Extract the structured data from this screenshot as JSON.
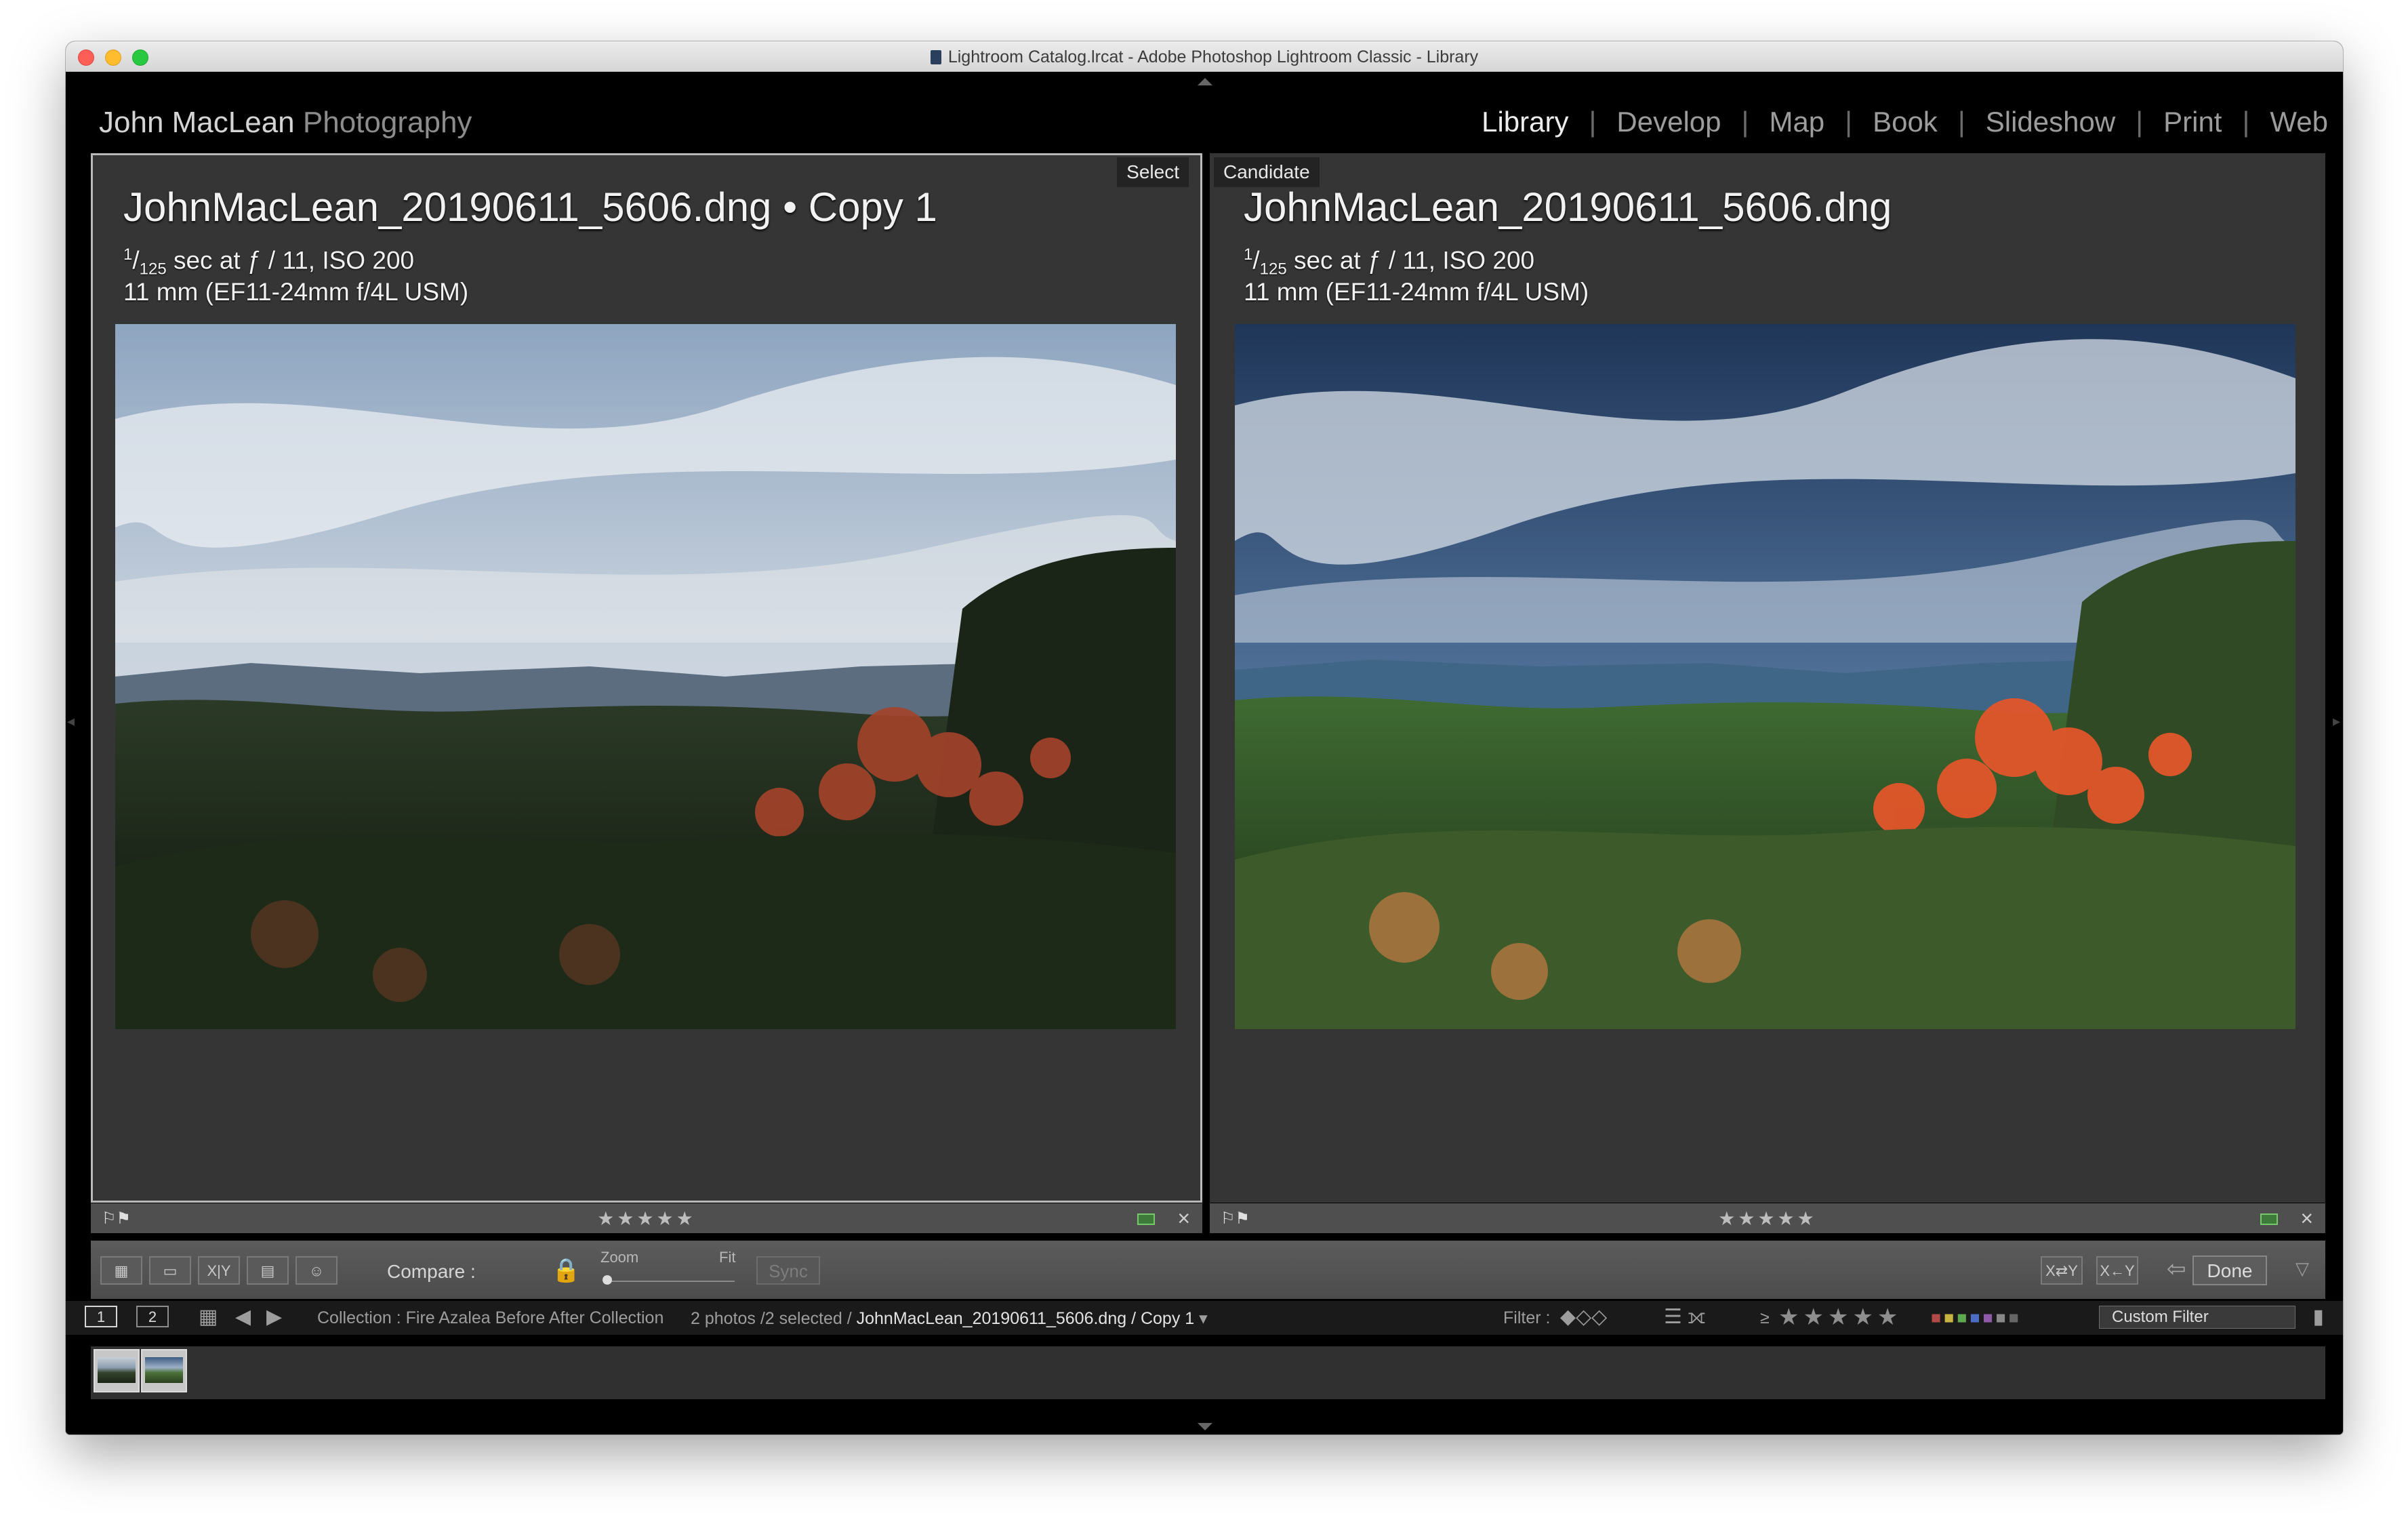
{
  "window": {
    "title": "Lightroom Catalog.lrcat - Adobe Photoshop Lightroom Classic - Library"
  },
  "identity_plate": {
    "name": "John MacLean",
    "subtitle": "Photography"
  },
  "modules": [
    {
      "label": "Library",
      "active": true
    },
    {
      "label": "Develop",
      "active": false
    },
    {
      "label": "Map",
      "active": false
    },
    {
      "label": "Book",
      "active": false
    },
    {
      "label": "Slideshow",
      "active": false
    },
    {
      "label": "Print",
      "active": false
    },
    {
      "label": "Web",
      "active": false
    }
  ],
  "select_pane": {
    "tag": "Select",
    "filename": "JohnMacLean_20190611_5606.dng  •  Copy 1",
    "shutter_num": "1",
    "shutter_den": "125",
    "exposure_rest": " sec at ƒ / 11, ISO 200",
    "lens": "11 mm (EF11-24mm f/4L USM)",
    "stars": "★★★★★"
  },
  "candidate_pane": {
    "tag": "Candidate",
    "filename": "JohnMacLean_20190611_5606.dng",
    "shutter_num": "1",
    "shutter_den": "125",
    "exposure_rest": " sec at ƒ / 11, ISO 200",
    "lens": "11 mm (EF11-24mm f/4L USM)",
    "stars": "★★★★★"
  },
  "toolbar": {
    "compare_label": "Compare :",
    "zoom_label": "Zoom",
    "fit_label": "Fit",
    "sync_label": "Sync",
    "done_label": "Done"
  },
  "filmstrip_bar": {
    "view1": "1",
    "view2": "2",
    "collection": "Collection : Fire Azalea Before After Collection",
    "photo_count": "2 photos /2 selected /",
    "current_file": "JohnMacLean_20190611_5606.dng / Copy 1",
    "filter_label": "Filter :",
    "rating_op": "≥",
    "rating_stars": "★★★★★",
    "custom_filter": "Custom Filter"
  },
  "colors": {
    "label_green": "#76c86b",
    "panel_bg": "#353535",
    "window_bg": "#000000"
  },
  "icons": [
    "grid-icon",
    "loupe-icon",
    "compare-icon",
    "survey-icon",
    "people-icon",
    "lock-icon",
    "flag-icon",
    "close-icon",
    "arrow-left-icon",
    "arrow-right-icon"
  ]
}
